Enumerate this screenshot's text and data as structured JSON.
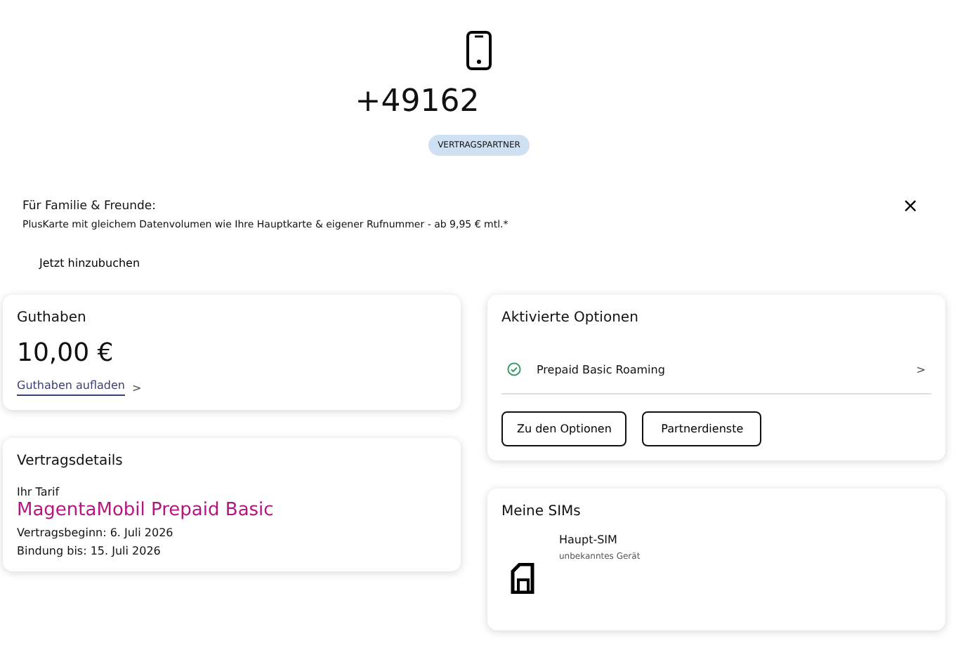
{
  "header": {
    "number": "+49162",
    "badge": "VERTRAGSPARTNER"
  },
  "banner": {
    "title": "Für Familie & Freunde:",
    "text": "PlusKarte mit gleichem Datenvolumen wie Ihre Hauptkarte & eigener Rufnummer - ab 9,95 € mtl.*",
    "close": "×",
    "action": "Jetzt hinzubuchen"
  },
  "balance": {
    "title": "Guthaben",
    "amount": "10,00 €",
    "link": "Guthaben aufladen",
    "chevron": ">"
  },
  "contract": {
    "title": "Vertragsdetails",
    "tariff_label": "Ihr Tarif",
    "tariff": "MagentaMobil Prepaid Basic",
    "lines": [
      "Vertragsbeginn:  6. Juli 2026",
      "Bindung bis:  15. Juli 2026"
    ]
  },
  "options": {
    "title": "Aktivierte Optionen",
    "items": [
      {
        "label": "Prepaid Basic Roaming",
        "active": true,
        "chevron": ">"
      }
    ],
    "buttons": [
      "Zu den Optionen",
      "Partnerdienste"
    ]
  },
  "sims": {
    "title": "Meine SIMs",
    "items": [
      {
        "name": "Haupt-SIM",
        "device": "unbekanntes Gerät"
      }
    ]
  }
}
